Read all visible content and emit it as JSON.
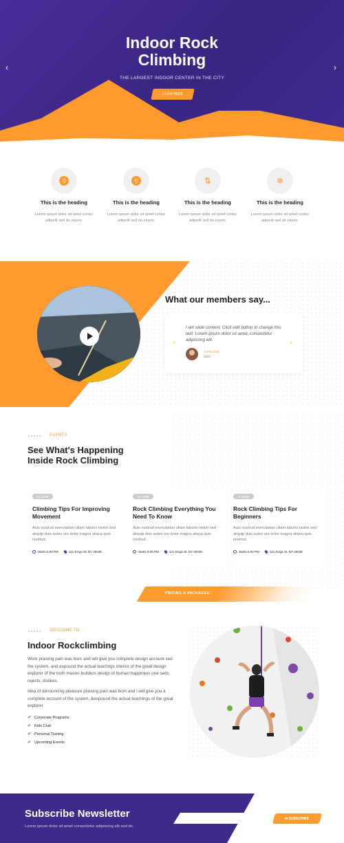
{
  "hero": {
    "title_line1": "Indoor Rock",
    "title_line2": "Climbing",
    "subtitle": "THE LARGEST INDOOR CENTER IN THE CITY",
    "button": "CLICK HERE",
    "prev_arrow": "‹",
    "next_arrow": "›"
  },
  "features": [
    {
      "icon": "person-circle-icon",
      "glyph": "⚲",
      "heading": "This is the heading",
      "text": "Lorem ipsum dolor sit amet contur adipelit sed do eiusm."
    },
    {
      "icon": "person-circle-icon",
      "glyph": "⚲",
      "heading": "This is the heading",
      "text": "Lorem ipsum dolor sit amet contur adipelit sed do eiusm."
    },
    {
      "icon": "sort-arrows-icon",
      "glyph": "⇅",
      "heading": "This is the heading",
      "text": "Lorem ipsum dolor sit amet contur adipelit sed do eiusm."
    },
    {
      "icon": "snowflake-icon",
      "glyph": "❄",
      "heading": "This is the heading",
      "text": "Lorem ipsum dolor sit amet contur adipelit sed do eiusm."
    }
  ],
  "testimonial": {
    "heading": "What our members say...",
    "text": "I am slide content. Click edit button to change this text. Lorem ipsum dolor sit amet, consectetur adipiscing elit.",
    "name": "JOHN DOE",
    "role": "CEO",
    "prev": "‹",
    "next": "›"
  },
  "events": {
    "kicker": "EVENTS",
    "title_line1": "See What's Happening",
    "title_line2": "Inside Rock Climbing",
    "items": [
      {
        "date": "12 JUNE",
        "title": "Climbing Tips For Improving Movement",
        "text": "Auis nostrud exercitation ullam laboris nisitm sed aliquip duis autes ure dolor magna aliqua quis nostrud.",
        "time": "Starts 5.00 PM",
        "location": "121 Kings St. NY 26038"
      },
      {
        "date": "18 JUNE",
        "title": "Rock Climbing Everything You Need To Know",
        "text": "Auis nostrud exercitation ullam laboris nisitm sed aliquip duis autes ure dolor magna aliqua quis nostrud.",
        "time": "Starts 5.00 PM",
        "location": "121 Kings St. NY 26038"
      },
      {
        "date": "24 JUNE",
        "title": "Rock Climbing Tips For Beginners",
        "text": "Auis nostrud exercitation ullam laboris nisitm sed aliquip duis autes ure dolor magna aliqua quis nostrud.",
        "time": "Starts 5.00 PM",
        "location": "121 Kings St. NY 26038"
      }
    ],
    "pricing_button": "PRICING & PACKAGES  ›"
  },
  "about": {
    "kicker": "WELCOME TO",
    "title": "Indoor Rockclimbing",
    "para1": "Work praising pain was born and will give you complete design account sed the system, and expound the actual teachngs interior of the great design explorer of the truth master-builders design of human happiness one seds rejects, dislikes.",
    "para2": "Idea of denouncing pleasure praising pain was born and i will give you a complete account of the system, &expound the actual teachings of the great explorer.",
    "list": [
      "Corporate Programs",
      "Kids Club",
      "Personal Traning",
      "Upcoming Events"
    ]
  },
  "newsletter": {
    "title": "Subscribe Newsletter",
    "text": "Lorem ipsum dolor sit amet consectetur adipiscing elit sed do.",
    "button": "SUBSCRIBE"
  },
  "colors": {
    "primary": "#3f2a8c",
    "accent": "#ff9a2e"
  }
}
